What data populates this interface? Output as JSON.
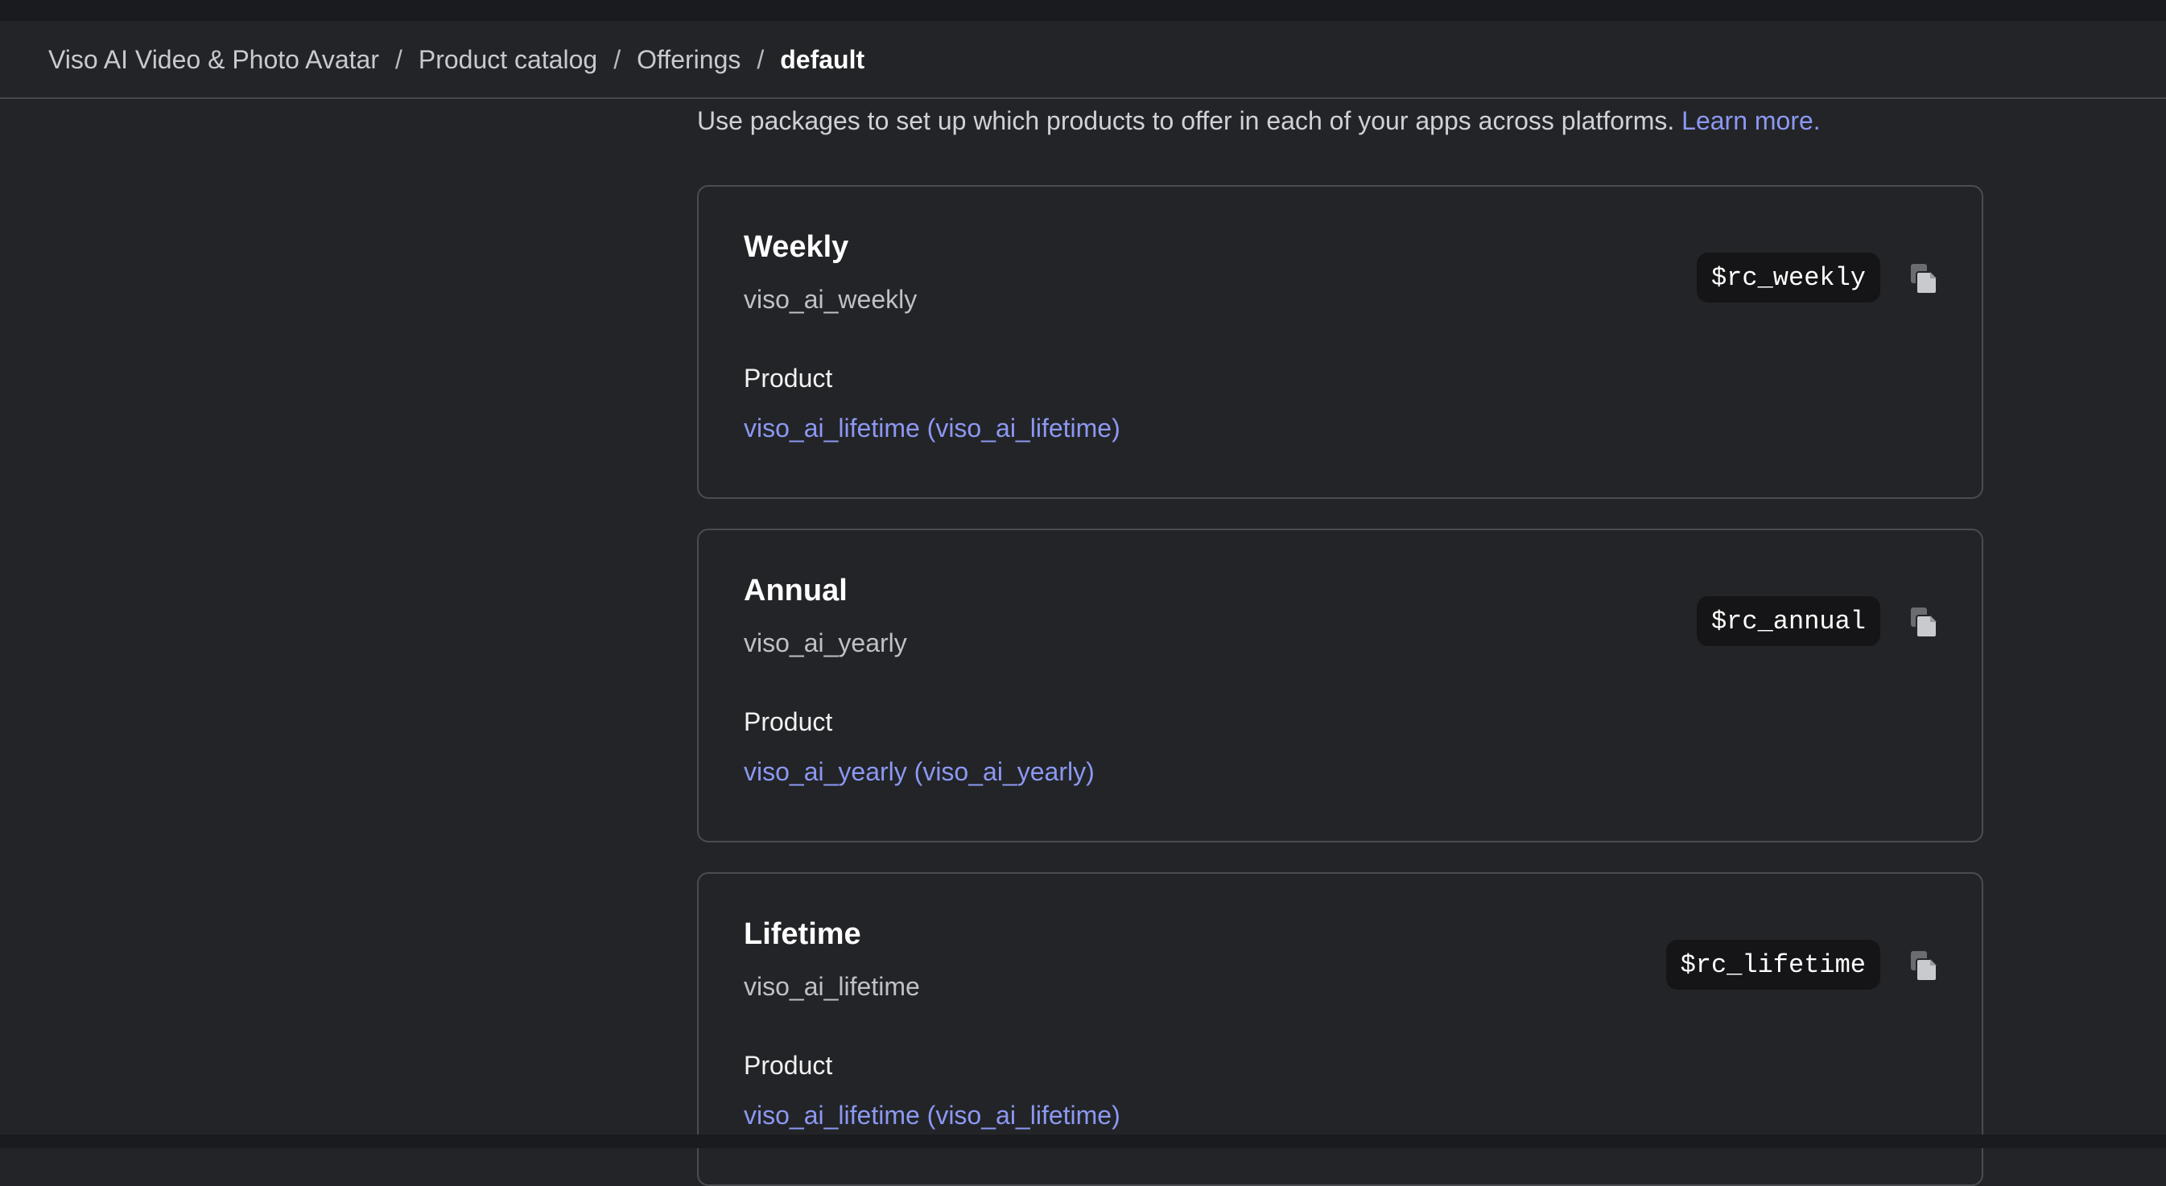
{
  "breadcrumb": {
    "items": [
      "Viso AI Video & Photo Avatar",
      "Product catalog",
      "Offerings"
    ],
    "separator": "/",
    "current": "default"
  },
  "intro": {
    "text": "Use packages to set up which products to offer in each of your apps across platforms.",
    "link": "Learn more."
  },
  "packages": [
    {
      "title": "Weekly",
      "identifier": "viso_ai_weekly",
      "product_label": "Product",
      "product_link": "viso_ai_lifetime (viso_ai_lifetime)",
      "package_key": "$rc_weekly",
      "icon": "copy-icon"
    },
    {
      "title": "Annual",
      "identifier": "viso_ai_yearly",
      "product_label": "Product",
      "product_link": "viso_ai_yearly (viso_ai_yearly)",
      "package_key": "$rc_annual",
      "icon": "copy-icon"
    },
    {
      "title": "Lifetime",
      "identifier": "viso_ai_lifetime",
      "product_label": "Product",
      "product_link": "viso_ai_lifetime (viso_ai_lifetime)",
      "package_key": "$rc_lifetime",
      "icon": "copy-icon"
    }
  ],
  "colors": {
    "background": "#232427",
    "link": "#8c98f2",
    "card_border": "#4a4c51",
    "pill_background": "#151517"
  }
}
